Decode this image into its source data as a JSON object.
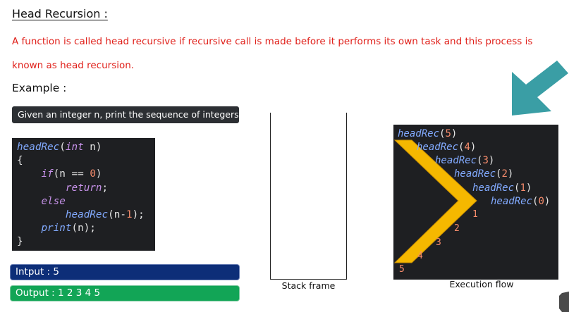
{
  "heading": "Head Recursion :",
  "description": "A function is called head recursive if recursive call is made before it performs its own task and this process is known as head recursion.",
  "example_label": "Example :",
  "problem": "Given an integer n, print the sequence of integers.",
  "code": {
    "line1_fn": "headRec",
    "line1_param_type": "int",
    "line1_param": " n)",
    "line2": "{",
    "line3_kw": "if",
    "line3_rest": "(n == ",
    "line3_num": "0",
    "line4_kw": "return",
    "line5_kw": "else",
    "line6_fn": "headRec",
    "line6_rest": "(n-",
    "line6_num": "1",
    "line7_fn": "print",
    "line7_rest": "(n);",
    "line8": "}"
  },
  "input_label": "Intput : 5",
  "output_label": "Output : 1 2 3 4 5",
  "stack_label": "Stack frame",
  "execution": {
    "label": "Execution flow",
    "calls": [
      {
        "fn": "headRec",
        "arg": "5"
      },
      {
        "fn": "headRec",
        "arg": "4"
      },
      {
        "fn": "headRec",
        "arg": "3"
      },
      {
        "fn": "headRec",
        "arg": "2"
      },
      {
        "fn": "headRec",
        "arg": "1"
      },
      {
        "fn": "headRec",
        "arg": "0"
      }
    ],
    "printed": [
      "1",
      "2",
      "3",
      "4",
      "5"
    ]
  },
  "colors": {
    "description_text": "#e0201a",
    "code_bg": "#1e1f22",
    "function_name": "#82aaff",
    "keyword": "#c792ea",
    "number": "#f78c6c",
    "input_bg": "#0d2e78",
    "output_bg": "#12a556",
    "flow_arrow": "#f5b800",
    "pointer_arrow": "#3a9ea5"
  },
  "icons": [
    "pointer-arrow-icon",
    "flow-chevron-icon"
  ]
}
